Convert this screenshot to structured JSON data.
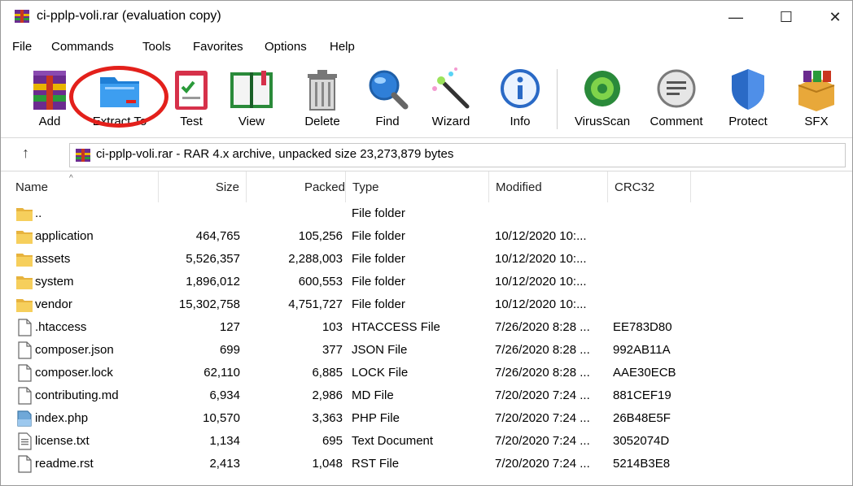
{
  "window": {
    "title": "ci-pplp-voli.rar (evaluation copy)",
    "controls": {
      "minimize": "—",
      "maximize": "☐",
      "close": "✕"
    }
  },
  "menu": [
    "File",
    "Commands",
    "Tools",
    "Favorites",
    "Options",
    "Help"
  ],
  "toolbar": [
    {
      "label": "Add",
      "icon": "add-archive-icon"
    },
    {
      "label": "Extract To",
      "icon": "extract-folder-icon"
    },
    {
      "label": "Test",
      "icon": "test-clipboard-icon"
    },
    {
      "label": "View",
      "icon": "view-book-icon"
    },
    {
      "label": "Delete",
      "icon": "trash-icon"
    },
    {
      "label": "Find",
      "icon": "magnifier-icon"
    },
    {
      "label": "Wizard",
      "icon": "wizard-wand-icon"
    },
    {
      "label": "Info",
      "icon": "info-icon"
    },
    {
      "label": "VirusScan",
      "icon": "virus-scan-icon"
    },
    {
      "label": "Comment",
      "icon": "comment-icon"
    },
    {
      "label": "Protect",
      "icon": "shield-icon"
    },
    {
      "label": "SFX",
      "icon": "sfx-box-icon"
    }
  ],
  "address": {
    "up": "↑",
    "text": "ci-pplp-voli.rar - RAR 4.x archive, unpacked size 23,273,879 bytes"
  },
  "columns": {
    "name": "Name",
    "size": "Size",
    "packed": "Packed",
    "type": "Type",
    "modified": "Modified",
    "crc": "CRC32",
    "sort_indicator": "^"
  },
  "files": [
    {
      "name": "..",
      "size": "",
      "packed": "",
      "type": "File folder",
      "modified": "",
      "crc": "",
      "kind": "folder"
    },
    {
      "name": "application",
      "size": "464,765",
      "packed": "105,256",
      "type": "File folder",
      "modified": "10/12/2020 10:...",
      "crc": "",
      "kind": "folder"
    },
    {
      "name": "assets",
      "size": "5,526,357",
      "packed": "2,288,003",
      "type": "File folder",
      "modified": "10/12/2020 10:...",
      "crc": "",
      "kind": "folder"
    },
    {
      "name": "system",
      "size": "1,896,012",
      "packed": "600,553",
      "type": "File folder",
      "modified": "10/12/2020 10:...",
      "crc": "",
      "kind": "folder"
    },
    {
      "name": "vendor",
      "size": "15,302,758",
      "packed": "4,751,727",
      "type": "File folder",
      "modified": "10/12/2020 10:...",
      "crc": "",
      "kind": "folder"
    },
    {
      "name": ".htaccess",
      "size": "127",
      "packed": "103",
      "type": "HTACCESS File",
      "modified": "7/26/2020 8:28 ...",
      "crc": "EE783D80",
      "kind": "file"
    },
    {
      "name": "composer.json",
      "size": "699",
      "packed": "377",
      "type": "JSON File",
      "modified": "7/26/2020 8:28 ...",
      "crc": "992AB11A",
      "kind": "file"
    },
    {
      "name": "composer.lock",
      "size": "62,110",
      "packed": "6,885",
      "type": "LOCK File",
      "modified": "7/26/2020 8:28 ...",
      "crc": "AAE30ECB",
      "kind": "file"
    },
    {
      "name": "contributing.md",
      "size": "6,934",
      "packed": "2,986",
      "type": "MD File",
      "modified": "7/20/2020 7:24 ...",
      "crc": "881CEF19",
      "kind": "file"
    },
    {
      "name": "index.php",
      "size": "10,570",
      "packed": "3,363",
      "type": "PHP File",
      "modified": "7/20/2020 7:24 ...",
      "crc": "26B48E5F",
      "kind": "php"
    },
    {
      "name": "license.txt",
      "size": "1,134",
      "packed": "695",
      "type": "Text Document",
      "modified": "7/20/2020 7:24 ...",
      "crc": "3052074D",
      "kind": "text"
    },
    {
      "name": "readme.rst",
      "size": "2,413",
      "packed": "1,048",
      "type": "RST File",
      "modified": "7/20/2020 7:24 ...",
      "crc": "5214B3E8",
      "kind": "file"
    }
  ]
}
